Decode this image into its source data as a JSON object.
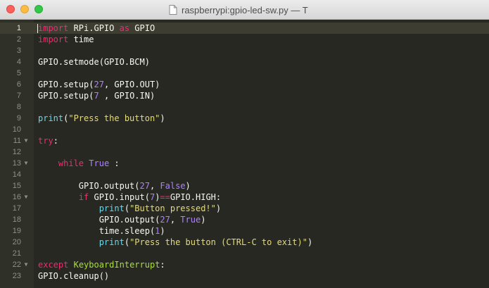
{
  "window": {
    "title": "raspberrypi:gpio-led-sw.py — T"
  },
  "editor": {
    "current_line": 1,
    "lines": [
      {
        "n": "1",
        "fold": "",
        "tokens": [
          {
            "t": "import",
            "c": "kw"
          },
          {
            "t": " RPi.GPIO ",
            "c": "ws"
          },
          {
            "t": "as",
            "c": "kw"
          },
          {
            "t": " GPIO",
            "c": "ws"
          }
        ]
      },
      {
        "n": "2",
        "fold": "",
        "tokens": [
          {
            "t": "import",
            "c": "kw"
          },
          {
            "t": " time",
            "c": "ws"
          }
        ]
      },
      {
        "n": "3",
        "fold": "",
        "tokens": []
      },
      {
        "n": "4",
        "fold": "",
        "tokens": [
          {
            "t": "GPIO.setmode(GPIO.BCM)",
            "c": "ws"
          }
        ]
      },
      {
        "n": "5",
        "fold": "",
        "tokens": []
      },
      {
        "n": "6",
        "fold": "",
        "tokens": [
          {
            "t": "GPIO.setup(",
            "c": "ws"
          },
          {
            "t": "27",
            "c": "num-lit"
          },
          {
            "t": ", GPIO.OUT)",
            "c": "ws"
          }
        ]
      },
      {
        "n": "7",
        "fold": "",
        "tokens": [
          {
            "t": "GPIO.setup(",
            "c": "ws"
          },
          {
            "t": "7",
            "c": "num-lit"
          },
          {
            "t": " , GPIO.IN)",
            "c": "ws"
          }
        ]
      },
      {
        "n": "8",
        "fold": "",
        "tokens": []
      },
      {
        "n": "9",
        "fold": "",
        "tokens": [
          {
            "t": "print",
            "c": "bi"
          },
          {
            "t": "(",
            "c": "ws"
          },
          {
            "t": "\"Press the button\"",
            "c": "str"
          },
          {
            "t": ")",
            "c": "ws"
          }
        ]
      },
      {
        "n": "10",
        "fold": "",
        "tokens": []
      },
      {
        "n": "11",
        "fold": "▼",
        "tokens": [
          {
            "t": "try",
            "c": "kw"
          },
          {
            "t": ":",
            "c": "ws"
          }
        ]
      },
      {
        "n": "12",
        "fold": "",
        "tokens": []
      },
      {
        "n": "13",
        "fold": "▼",
        "tokens": [
          {
            "t": "    ",
            "c": "ws"
          },
          {
            "t": "while",
            "c": "kw"
          },
          {
            "t": " ",
            "c": "ws"
          },
          {
            "t": "True",
            "c": "const"
          },
          {
            "t": " :",
            "c": "ws"
          }
        ]
      },
      {
        "n": "14",
        "fold": "",
        "tokens": []
      },
      {
        "n": "15",
        "fold": "",
        "tokens": [
          {
            "t": "        GPIO.output(",
            "c": "ws"
          },
          {
            "t": "27",
            "c": "num-lit"
          },
          {
            "t": ", ",
            "c": "ws"
          },
          {
            "t": "False",
            "c": "const"
          },
          {
            "t": ")",
            "c": "ws"
          }
        ]
      },
      {
        "n": "16",
        "fold": "▼",
        "tokens": [
          {
            "t": "        ",
            "c": "ws"
          },
          {
            "t": "if",
            "c": "kw"
          },
          {
            "t": " GPIO.input(",
            "c": "ws"
          },
          {
            "t": "7",
            "c": "num-lit"
          },
          {
            "t": ")",
            "c": "ws"
          },
          {
            "t": "==",
            "c": "op"
          },
          {
            "t": "GPIO.HIGH:",
            "c": "ws"
          }
        ]
      },
      {
        "n": "17",
        "fold": "",
        "tokens": [
          {
            "t": "            ",
            "c": "ws"
          },
          {
            "t": "print",
            "c": "bi"
          },
          {
            "t": "(",
            "c": "ws"
          },
          {
            "t": "\"Button pressed!\"",
            "c": "str"
          },
          {
            "t": ")",
            "c": "ws"
          }
        ]
      },
      {
        "n": "18",
        "fold": "",
        "tokens": [
          {
            "t": "            GPIO.output(",
            "c": "ws"
          },
          {
            "t": "27",
            "c": "num-lit"
          },
          {
            "t": ", ",
            "c": "ws"
          },
          {
            "t": "True",
            "c": "const"
          },
          {
            "t": ")",
            "c": "ws"
          }
        ]
      },
      {
        "n": "19",
        "fold": "",
        "tokens": [
          {
            "t": "            time.sleep(",
            "c": "ws"
          },
          {
            "t": "1",
            "c": "num-lit"
          },
          {
            "t": ")",
            "c": "ws"
          }
        ]
      },
      {
        "n": "20",
        "fold": "",
        "tokens": [
          {
            "t": "            ",
            "c": "ws"
          },
          {
            "t": "print",
            "c": "bi"
          },
          {
            "t": "(",
            "c": "ws"
          },
          {
            "t": "\"Press the button (CTRL-C to exit)\"",
            "c": "str"
          },
          {
            "t": ")",
            "c": "ws"
          }
        ]
      },
      {
        "n": "21",
        "fold": "",
        "tokens": []
      },
      {
        "n": "22",
        "fold": "▼",
        "tokens": [
          {
            "t": "except",
            "c": "kw"
          },
          {
            "t": " ",
            "c": "ws"
          },
          {
            "t": "KeyboardInterrupt",
            "c": "cls"
          },
          {
            "t": ":",
            "c": "ws"
          }
        ]
      },
      {
        "n": "23",
        "fold": "",
        "tokens": [
          {
            "t": "GPIO.cleanup()",
            "c": "ws"
          }
        ]
      }
    ]
  },
  "colors": {
    "background": "#272822",
    "gutter": "#2f3129",
    "keyword": "#f92672",
    "builtin": "#66d9ef",
    "string": "#e6db74",
    "number": "#ae81ff",
    "class": "#a6e22e"
  },
  "icons": {
    "document": "document-icon"
  }
}
